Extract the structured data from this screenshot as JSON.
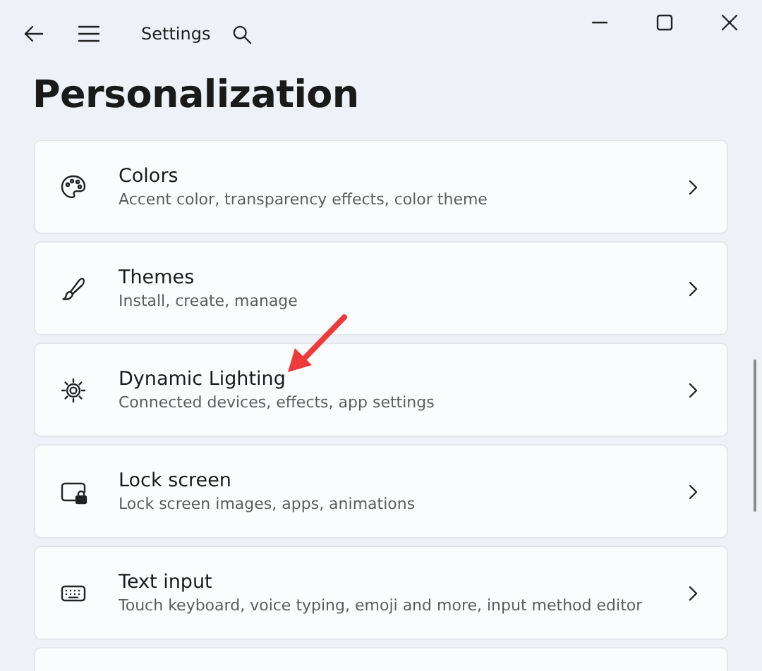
{
  "window": {
    "title": "Settings"
  },
  "page_title": "Personalization",
  "items": [
    {
      "title": "Colors",
      "subtitle": "Accent color, transparency effects, color theme"
    },
    {
      "title": "Themes",
      "subtitle": "Install, create, manage"
    },
    {
      "title": "Dynamic Lighting",
      "subtitle": "Connected devices, effects, app settings"
    },
    {
      "title": "Lock screen",
      "subtitle": "Lock screen images, apps, animations"
    },
    {
      "title": "Text input",
      "subtitle": "Touch keyboard, voice typing, emoji and more, input method editor"
    }
  ]
}
